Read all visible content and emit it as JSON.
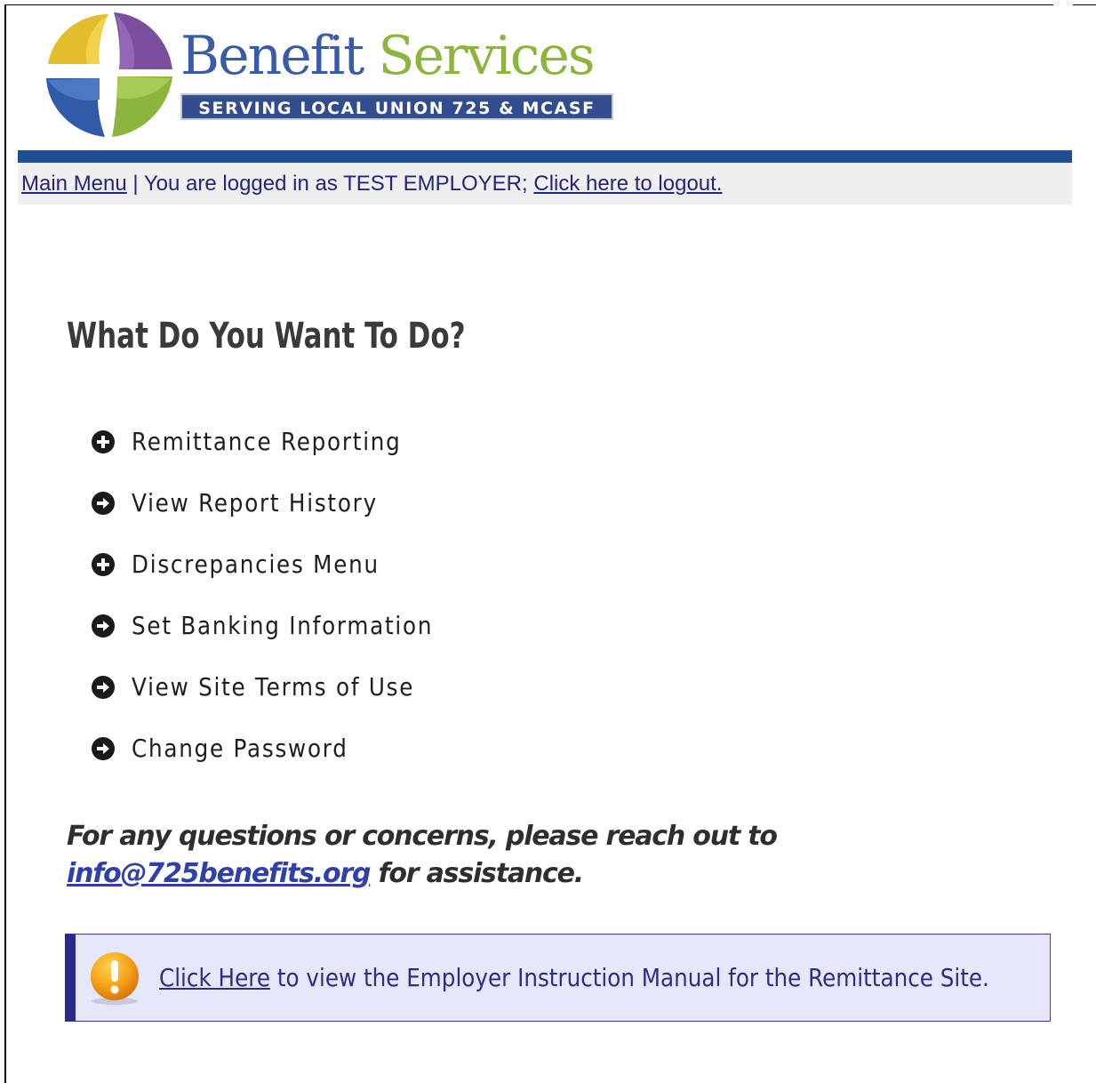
{
  "logo": {
    "title_word1": "Benefit",
    "title_word2": "Services",
    "tagline": "SERVING LOCAL UNION 725 & MCASF",
    "colors": {
      "blue": "#3a5ba5",
      "green": "#8bb53c",
      "yellow": "#e3bd2c",
      "purple": "#7b4f9e",
      "navy": "#324c8e"
    }
  },
  "nav": {
    "main_menu_link": "Main Menu",
    "separator": "|",
    "logged_in_text": "You are logged in as TEST EMPLOYER;",
    "logout_link": "Click here to logout."
  },
  "main": {
    "title": "What Do You Want To Do?",
    "menu_items": [
      {
        "label": "Remittance Reporting",
        "icon": "plus-circle-icon"
      },
      {
        "label": "View Report History",
        "icon": "arrow-right-circle-icon"
      },
      {
        "label": "Discrepancies Menu",
        "icon": "plus-circle-icon"
      },
      {
        "label": "Set Banking Information",
        "icon": "arrow-right-circle-icon"
      },
      {
        "label": "View Site Terms of Use",
        "icon": "arrow-right-circle-icon"
      },
      {
        "label": "Change Password",
        "icon": "arrow-right-circle-icon"
      }
    ],
    "contact": {
      "prefix": "For any questions or concerns, please reach out to",
      "email": "info@725benefits.org",
      "suffix": "for assistance."
    },
    "notice": {
      "icon": "exclamation-warning-icon",
      "link_text": "Click Here",
      "text": "to view the Employer Instruction Manual for the Remittance Site."
    }
  }
}
